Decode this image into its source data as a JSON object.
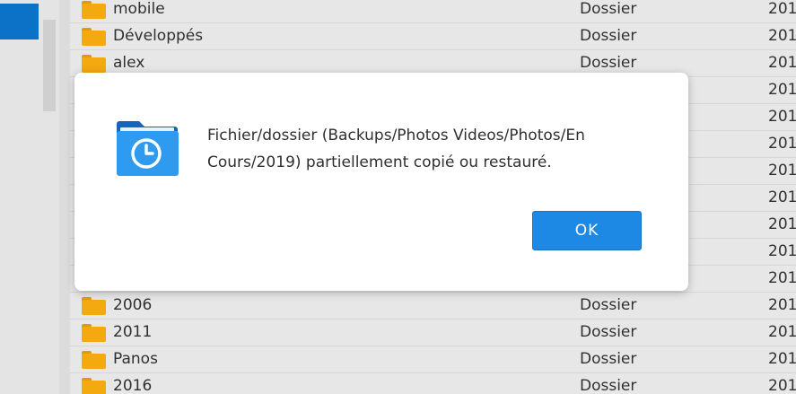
{
  "file_list": {
    "rows": [
      {
        "name": "mobile",
        "type": "Dossier",
        "date": "201"
      },
      {
        "name": "Développés",
        "type": "Dossier",
        "date": "201"
      },
      {
        "name": "alex",
        "type": "Dossier",
        "date": "201"
      },
      {
        "name": "",
        "type": "",
        "date": "201"
      },
      {
        "name": "",
        "type": "",
        "date": "201"
      },
      {
        "name": "",
        "type": "",
        "date": "201"
      },
      {
        "name": "",
        "type": "",
        "date": "201"
      },
      {
        "name": "",
        "type": "",
        "date": "201"
      },
      {
        "name": "",
        "type": "",
        "date": "201"
      },
      {
        "name": "",
        "type": "",
        "date": "201"
      },
      {
        "name": "",
        "type": "",
        "date": "201"
      },
      {
        "name": "2006",
        "type": "Dossier",
        "date": "201"
      },
      {
        "name": "2011",
        "type": "Dossier",
        "date": "201"
      },
      {
        "name": "Panos",
        "type": "Dossier",
        "date": "201"
      },
      {
        "name": "2016",
        "type": "Dossier",
        "date": "201"
      }
    ]
  },
  "dialog": {
    "icon": "folder-clock-icon",
    "message": "Fichier/dossier (Backups/Photos Videos/Photos/En Cours/2019) partiellement copié ou restauré.",
    "ok_label": "OK"
  },
  "colors": {
    "accent": "#1e88e5",
    "folder": "#f3a90f",
    "side_tile": "#0b72c7"
  }
}
